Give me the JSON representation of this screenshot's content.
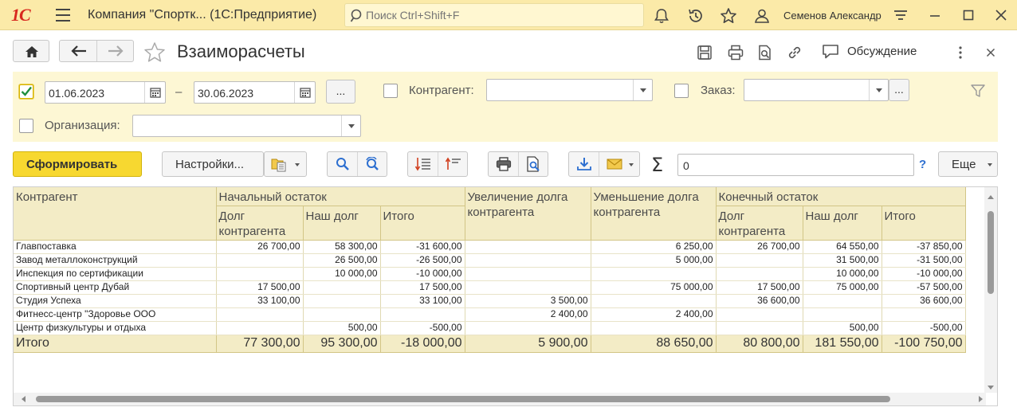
{
  "app": {
    "logo": "1С",
    "title": "Компания \"Спортк...  (1С:Предприятие)",
    "search_placeholder": "Поиск Ctrl+Shift+F",
    "user": "Семенов Александр"
  },
  "form": {
    "title": "Взаиморасчеты",
    "discussion_label": "Обсуждение"
  },
  "filters": {
    "period_checked": true,
    "date_from": "01.06.2023",
    "date_separator": "–",
    "date_to": "30.06.2023",
    "ellipsis": "...",
    "counterparty_label": "Контрагент:",
    "counterparty_value": "",
    "order_label": "Заказ:",
    "order_value": "",
    "organization_label": "Организация:",
    "organization_value": ""
  },
  "toolbar": {
    "generate_label": "Сформировать",
    "settings_label": "Настройки...",
    "sum_value": "0",
    "help_label": "?",
    "more_label": "Еще"
  },
  "report": {
    "headers": {
      "counterparty": "Контрагент",
      "opening_balance": "Начальный остаток",
      "debt_increase": "Увеличение долга контрагента",
      "debt_decrease": "Уменьшение долга контрагента",
      "closing_balance": "Конечный остаток",
      "counterparty_debt": "Долг контрагента",
      "our_debt": "Наш долг",
      "total": "Итого"
    },
    "rows": [
      {
        "name": "Главпоставка",
        "open_cp": "26 700,00",
        "open_our": "58 300,00",
        "open_total": "-31 600,00",
        "inc": "",
        "dec": "6 250,00",
        "close_cp": "26 700,00",
        "close_our": "64 550,00",
        "close_total": "-37 850,00"
      },
      {
        "name": "Завод металлоконструкций",
        "open_cp": "",
        "open_our": "26 500,00",
        "open_total": "-26 500,00",
        "inc": "",
        "dec": "5 000,00",
        "close_cp": "",
        "close_our": "31 500,00",
        "close_total": "-31 500,00"
      },
      {
        "name": "Инспекция по сертификации",
        "open_cp": "",
        "open_our": "10 000,00",
        "open_total": "-10 000,00",
        "inc": "",
        "dec": "",
        "close_cp": "",
        "close_our": "10 000,00",
        "close_total": "-10 000,00"
      },
      {
        "name": "Спортивный центр Дубай",
        "open_cp": "17 500,00",
        "open_our": "",
        "open_total": "17 500,00",
        "inc": "",
        "dec": "75 000,00",
        "close_cp": "17 500,00",
        "close_our": "75 000,00",
        "close_total": "-57 500,00"
      },
      {
        "name": "Студия Успеха",
        "open_cp": "33 100,00",
        "open_our": "",
        "open_total": "33 100,00",
        "inc": "3 500,00",
        "dec": "",
        "close_cp": "36 600,00",
        "close_our": "",
        "close_total": "36 600,00"
      },
      {
        "name": "Фитнесс-центр \"Здоровье ООО",
        "open_cp": "",
        "open_our": "",
        "open_total": "",
        "inc": "2 400,00",
        "dec": "2 400,00",
        "close_cp": "",
        "close_our": "",
        "close_total": ""
      },
      {
        "name": "Центр физкультуры и отдыха",
        "open_cp": "",
        "open_our": "500,00",
        "open_total": "-500,00",
        "inc": "",
        "dec": "",
        "close_cp": "",
        "close_our": "500,00",
        "close_total": "-500,00"
      }
    ],
    "totals": {
      "name": "Итого",
      "open_cp": "77 300,00",
      "open_our": "95 300,00",
      "open_total": "-18 000,00",
      "inc": "5 900,00",
      "dec": "88 650,00",
      "close_cp": "80 800,00",
      "close_our": "181 550,00",
      "close_total": "-100 750,00"
    }
  },
  "colors": {
    "topbar": "#fbeaa8",
    "filter_panel": "#fdf7d4",
    "primary_button": "#f7d830",
    "table_header": "#f3ecc6",
    "logo_red": "#d8291f"
  }
}
